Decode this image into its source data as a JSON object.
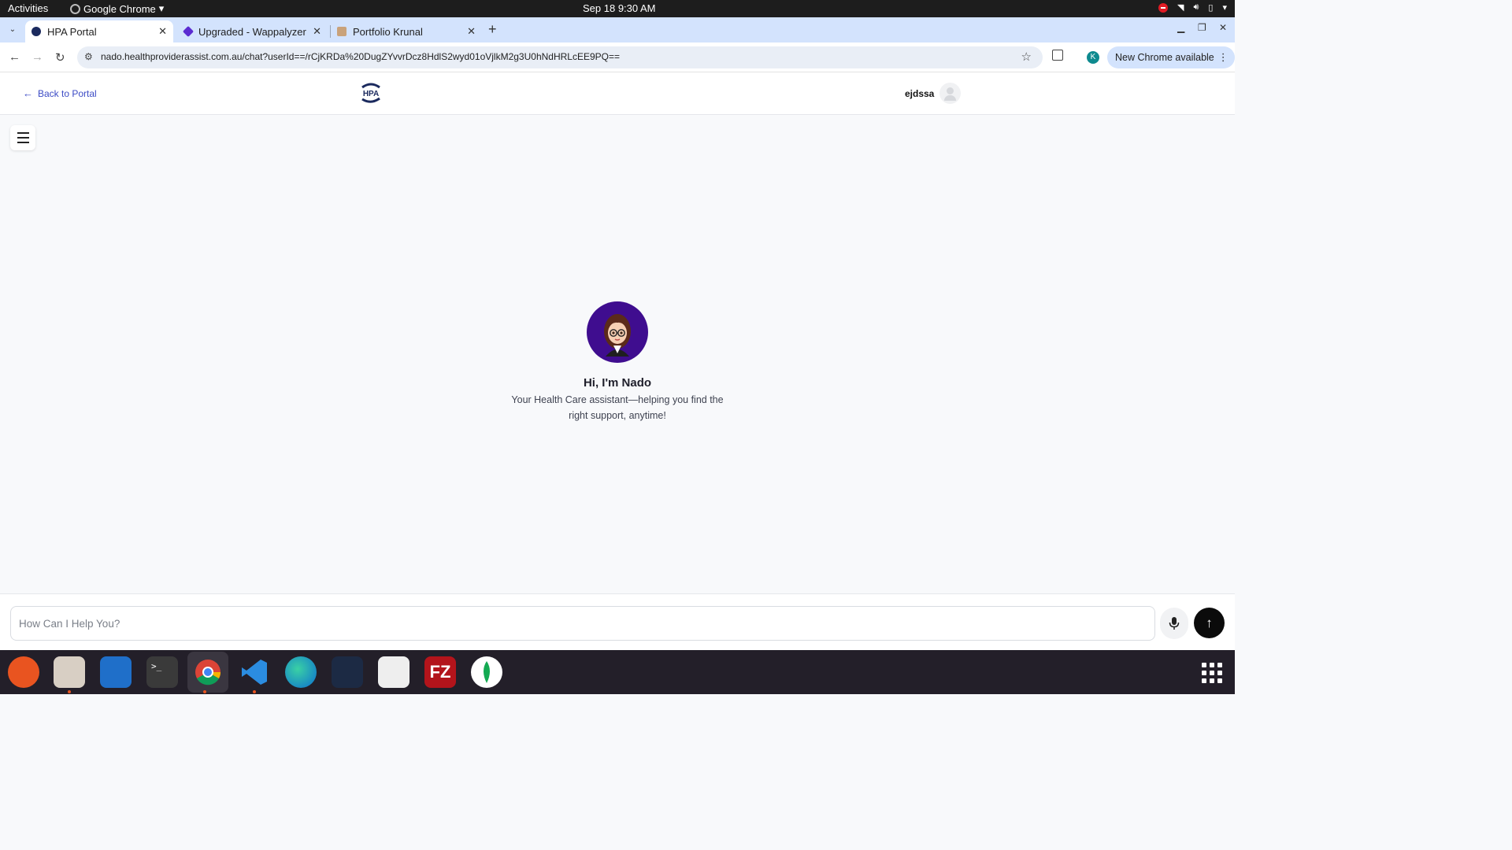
{
  "system_bar": {
    "activities": "Activities",
    "app_name": "Google Chrome",
    "clock": "Sep 18  9:30 AM"
  },
  "browser": {
    "tabs": [
      {
        "title": "HPA Portal",
        "active": true
      },
      {
        "title": "Upgraded - Wappalyzer",
        "active": false
      },
      {
        "title": "Portfolio Krunal",
        "active": false
      }
    ],
    "url": "nado.healthproviderassist.com.au/chat?userId==/rCjKRDa%20DugZYvvrDcz8HdlS2wyd01oVjlkM2g3U0hNdHRLcEE9PQ==",
    "profile_initial": "K",
    "update_label": "New Chrome available"
  },
  "page": {
    "back_label": "Back to Portal",
    "logo_text": "HPA",
    "username": "ejdssa",
    "welcome_title": "Hi, I'm Nado",
    "welcome_subtitle": "Your Health Care assistant—helping you find the right support, anytime!",
    "input_placeholder": "How Can I Help You?"
  },
  "colors": {
    "accent_link": "#3c4bc5",
    "avatar_bg": "#3f0d8f",
    "send_button": "#0b0b0b"
  },
  "dock_icons": [
    "pen-tool-icon",
    "files-icon",
    "text-editor-icon",
    "terminal-icon",
    "chrome-icon",
    "vscode-icon",
    "edge-icon",
    "cloud-app-icon",
    "document-viewer-icon",
    "filezilla-icon",
    "mongodb-icon"
  ]
}
